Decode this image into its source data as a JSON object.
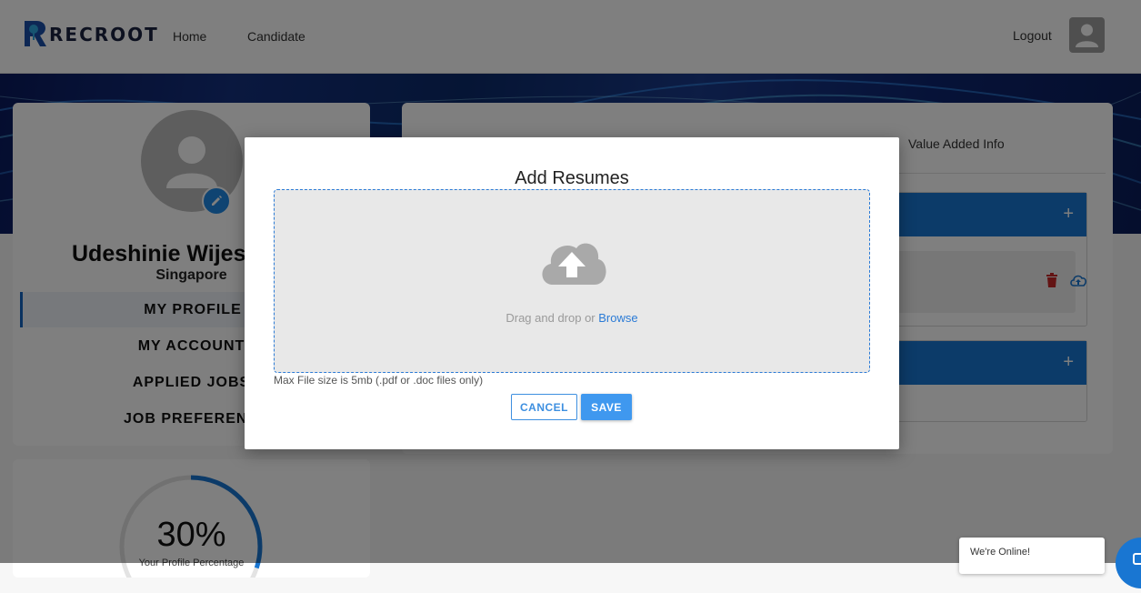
{
  "header": {
    "logo_text": "RECROOT",
    "nav": {
      "home": "Home",
      "candidate": "Candidate"
    },
    "logout": "Logout"
  },
  "profile": {
    "name": "Udeshinie Wijes",
    "location": "Singapore",
    "menu": [
      "MY PROFILE",
      "MY ACCOUNT",
      "APPLIED JOBS",
      "JOB PREFERENC"
    ],
    "completion": {
      "value": "30%",
      "fraction": 0.3,
      "caption": "Your Profile Percentage"
    }
  },
  "right_panel": {
    "tab": "Value Added Info"
  },
  "modal": {
    "title": "Add Resumes",
    "drop_text": "Drag and drop or ",
    "browse": "Browse",
    "max_size": "Max File size is 5mb (.pdf or .doc files only)",
    "cancel": "CANCEL",
    "save": "SAVE"
  },
  "chat": {
    "status": "We're Online!"
  },
  "colors": {
    "brand_blue": "#1976d2",
    "accent_blue": "#3f98ef",
    "delete_red": "#c62828"
  }
}
